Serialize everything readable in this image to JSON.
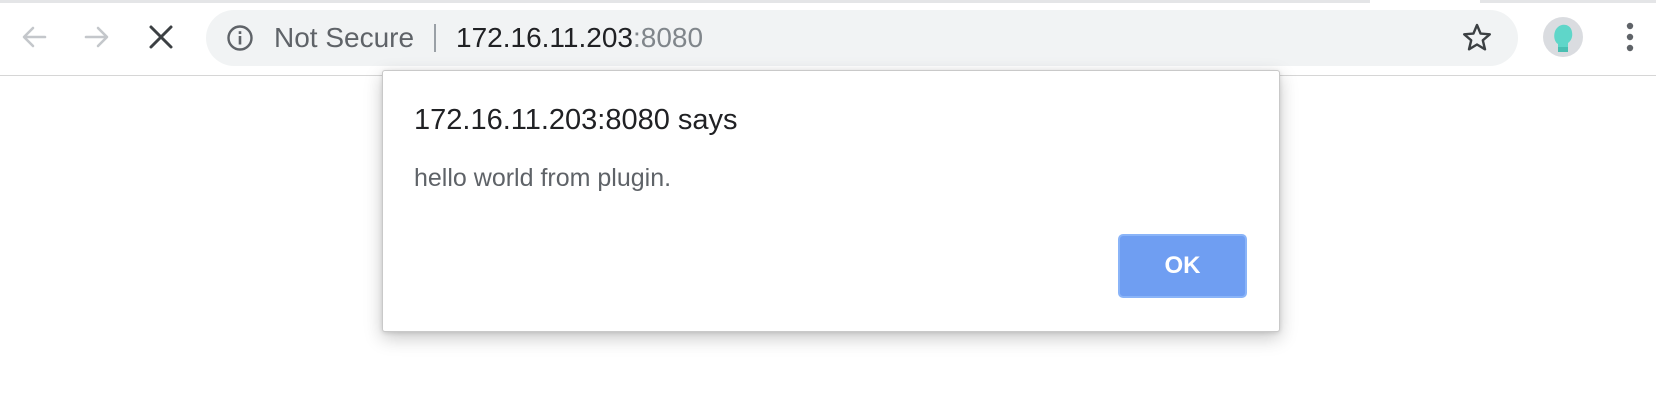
{
  "browser": {
    "security_label": "Not Secure",
    "url_host": "172.16.11.203",
    "url_port": ":8080",
    "icons": {
      "back": "arrow-left-icon",
      "forward": "arrow-right-icon",
      "stop": "close-icon",
      "info": "info-icon",
      "bookmark": "star-icon",
      "profile": "avatar",
      "menu": "more-vertical-icon"
    }
  },
  "dialog": {
    "title": "172.16.11.203:8080 says",
    "message": "hello world from plugin.",
    "ok_label": "OK"
  },
  "colors": {
    "ok_button": "#6f9ef2",
    "omnibox_bg": "#f1f3f4",
    "avatar_accent": "#5fd6c9"
  }
}
